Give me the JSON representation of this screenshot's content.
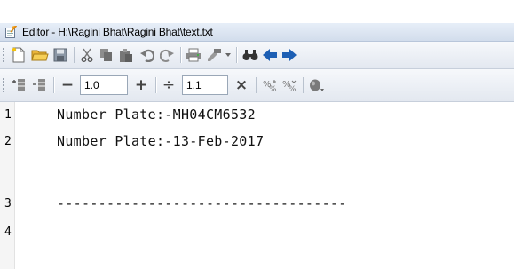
{
  "window": {
    "title": "Editor - H:\\Ragini Bhat\\Ragini Bhat\\text.txt"
  },
  "toolbar1": {
    "icons": [
      "new-file-icon",
      "open-folder-icon",
      "save-icon",
      "cut-icon",
      "copy-icon",
      "paste-icon",
      "undo-icon",
      "redo-icon",
      "print-icon",
      "print-preview-icon",
      "dropdown-icon",
      "find-icon",
      "back-arrow-icon",
      "forward-arrow-icon"
    ]
  },
  "toolbar2": {
    "minus_label": "−",
    "plus_label": "+",
    "divide_label": "÷",
    "times_label": "×",
    "value1": "1.0",
    "value2": "1.1"
  },
  "editor": {
    "lines": [
      {
        "number": "1",
        "text": "Number Plate:-MH04CM6532"
      },
      {
        "number": "2",
        "text": "Number Plate:-13-Feb-2017"
      },
      {
        "number": "3",
        "text": "-----------------------------------"
      },
      {
        "number": "4",
        "text": ""
      }
    ]
  }
}
